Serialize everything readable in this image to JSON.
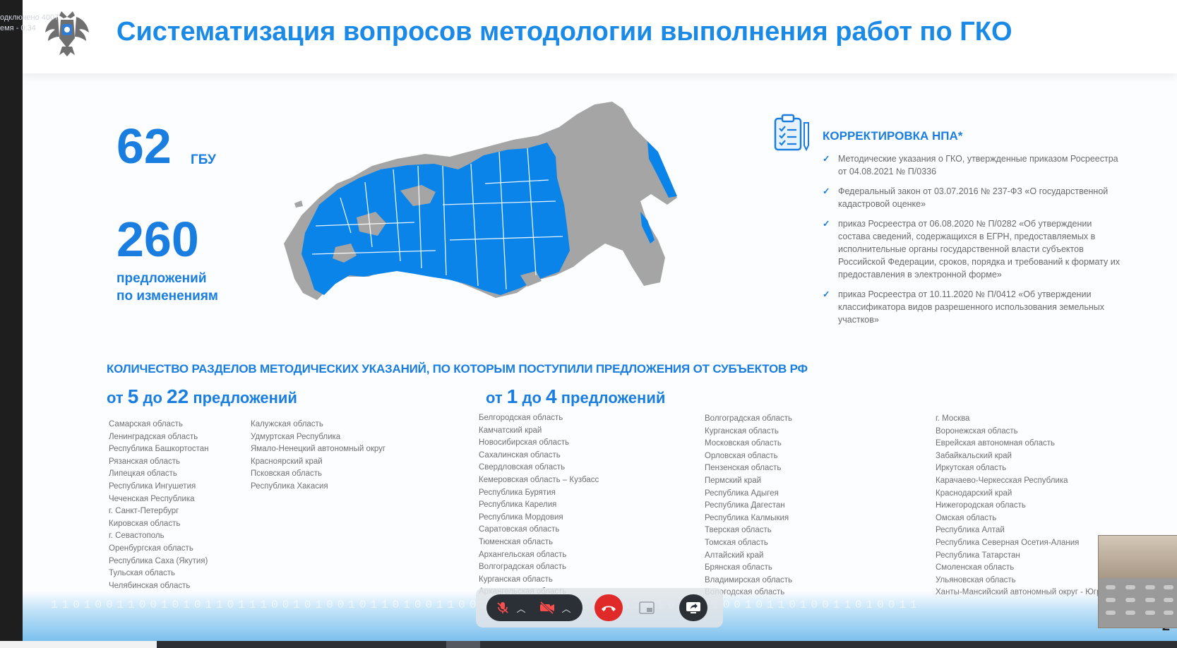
{
  "overlay": {
    "line1": "одключено 4007",
    "line2": "емя - 0:34"
  },
  "slide": {
    "title": "Систематизация вопросов методологии выполнения работ по ГКО",
    "stats": {
      "gbu_value": "62",
      "gbu_label": "ГБУ",
      "proposals_value": "260",
      "proposals_label": "предложений\nпо изменениям"
    },
    "npa": {
      "title": "КОРРЕКТИРОВКА НПА*",
      "items": [
        "Методические указания о ГКО, утвержденные приказом Росреестра от 04.08.2021 № П/0336",
        "Федеральный закон от 03.07.2016 № 237-ФЗ «О государственной кадастровой оценке»",
        "приказ Росреестра от 06.08.2020 № П/0282 «Об утверждении состава сведений, содержащихся в ЕГРН, предоставляемых в исполнительные органы государственной власти субъектов Российской Федерации, сроков, порядка и требований к формату их предоставления в электронной форме»",
        "приказ Росреестра от 10.11.2020 № П/0412 «Об утверждении классификатора видов разрешенного использования земельных участков»"
      ]
    },
    "sections_title": "КОЛИЧЕСТВО РАЗДЕЛОВ МЕТОДИЧЕСКИХ УКАЗАНИЙ, ПО КОТОРЫМ ПОСТУПИЛИ ПРЕДЛОЖЕНИЯ ОТ СУБЪЕКТОВ РФ",
    "range_high": {
      "from_word": "от",
      "from": "5",
      "to_word": "до",
      "to": "22",
      "suffix": "предложений"
    },
    "range_low": {
      "from_word": "от",
      "from": "1",
      "to_word": "до",
      "to": "4",
      "suffix": "предложений"
    },
    "high_col1": [
      "Самарская область",
      "Ленинградская область",
      "Республика Башкортостан",
      "Рязанская область",
      "Липецкая область",
      "Республика Ингушетия",
      "Чеченская Республика",
      "г. Санкт-Петербург",
      "Кировская область",
      "г. Севастополь",
      "Оренбургская область",
      "Республика Саха (Якутия)",
      "Тульская область",
      "Челябинская область"
    ],
    "high_col2": [
      "Калужская область",
      "Удмуртская Республика",
      "Ямало-Ненецкий автономный округ",
      "Красноярский край",
      "Псковская область",
      "Республика Хакасия"
    ],
    "low_col1": [
      "Белгородская область",
      "Камчатский край",
      "Новосибирская область",
      "Сахалинская область",
      "Свердловская область",
      "Кемеровская область – Кузбасс",
      "Республика Бурятия",
      "Республика Карелия",
      "Республика Мордовия",
      "Саратовская область",
      "Тюменская область",
      "Архангельская область",
      "Волгоградская область",
      "Курганская область",
      "Архангельская область"
    ],
    "low_col2": [
      "Волгоградская область",
      "Курганская область",
      "Московская область",
      "Орловская область",
      "Пензенская область",
      "Пермский край",
      "Республика Адыгея",
      "Республика Дагестан",
      "Республика Калмыкия",
      "Тверская область",
      "Томская область",
      "Алтайский край",
      "Брянская область",
      "Владимирская область",
      "Вологодская область"
    ],
    "low_col3": [
      "г. Москва",
      "Воронежская область",
      "Еврейская автономная область",
      "Забайкальский край",
      "Иркутская область",
      "Карачаево-Черкесская Республика",
      "Краснодарский край",
      "Нижегородская область",
      "Омская область",
      "Республика Алтай",
      "Республика Северная Осетия-Алания",
      "Республика Татарстан",
      "Смоленская область",
      "Ульяновская область",
      "Ханты-Мансийский автономный округ - Югра"
    ],
    "footer_digits": "1101001100101011011100101001011010011001010110101001110100101001011010011010011",
    "page_number": "2"
  },
  "colors": {
    "accent": "#1a7ee0",
    "map_blue": "#0a84e8",
    "map_gray": "#a5a5a5",
    "hangup": "#e02a2a",
    "toolbar_dark": "#2b2f36"
  },
  "icons": {
    "emblem": "double-headed-eagle-emblem",
    "npa": "clipboard-checklist-icon",
    "mic": "mic-off-icon",
    "camera": "camera-off-icon",
    "hangup": "phone-hangup-icon",
    "pip": "picture-in-picture-icon",
    "share": "screen-share-icon"
  }
}
